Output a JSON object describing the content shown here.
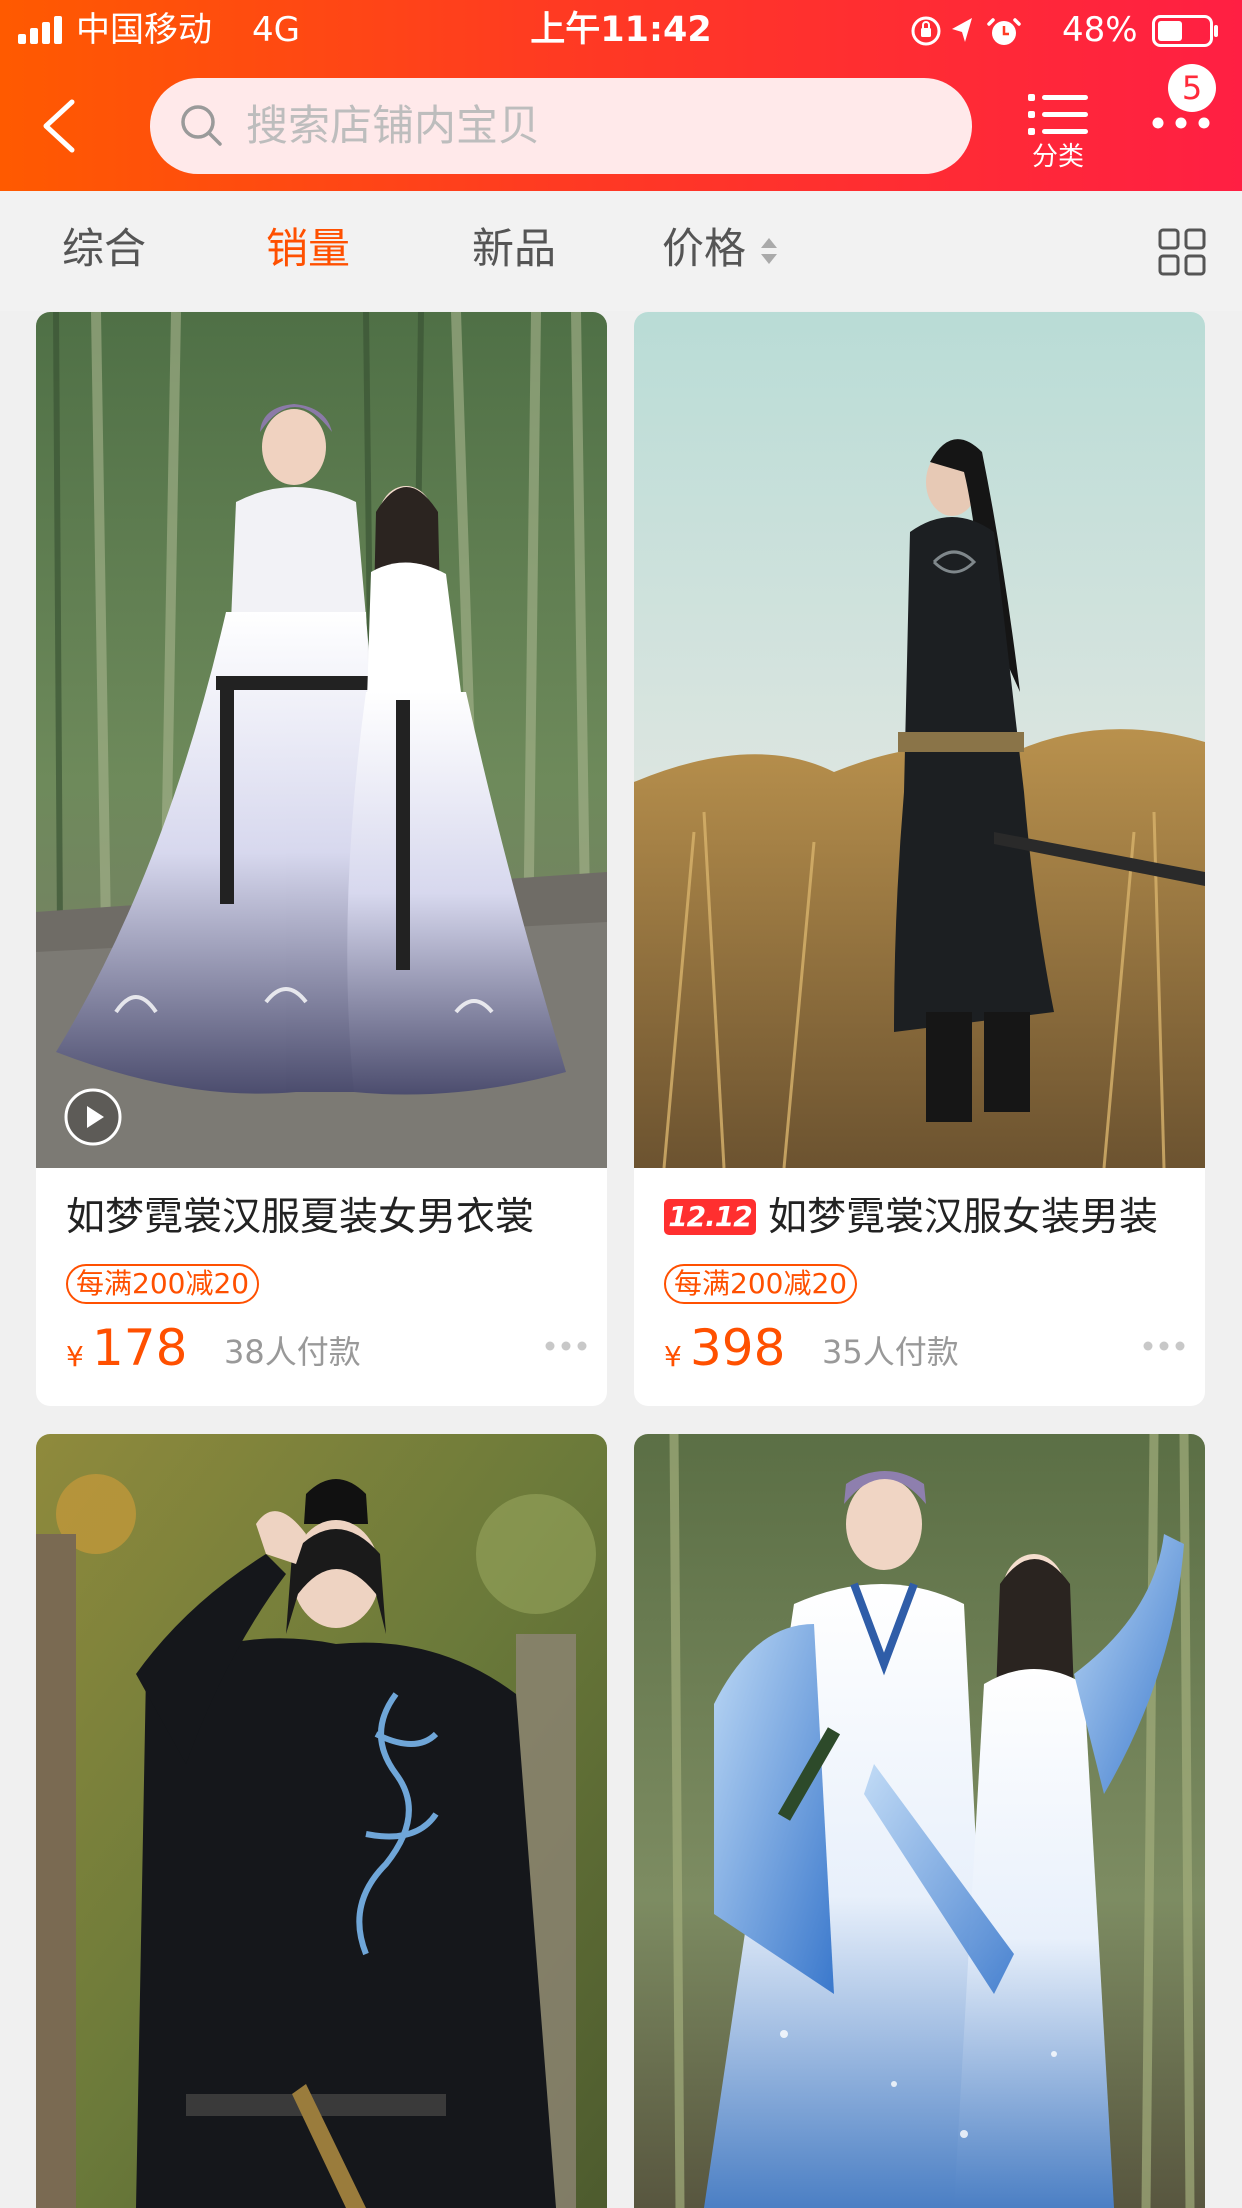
{
  "status_bar": {
    "carrier": "中国移动",
    "network": "4G",
    "time": "上午11:42",
    "battery": "48%",
    "battery_level": 0.48
  },
  "search": {
    "placeholder": "搜索店铺内宝贝"
  },
  "header": {
    "category_label": "分类",
    "notification_count": "5"
  },
  "filters": {
    "tabs": [
      {
        "label": "综合",
        "active": false
      },
      {
        "label": "销量",
        "active": true
      },
      {
        "label": "新品",
        "active": false
      },
      {
        "label": "价格",
        "active": false
      }
    ]
  },
  "products": [
    {
      "title": "如梦霓裳汉服夏装女男衣裳",
      "tag": "",
      "coupon": "每满200减20",
      "currency": "¥",
      "price": "178",
      "sold": "38人付款",
      "has_video": true
    },
    {
      "title": "如梦霓裳汉服女装男装",
      "tag": "12.12",
      "coupon": "每满200减20",
      "currency": "¥",
      "price": "398",
      "sold": "35人付款",
      "has_video": false
    },
    {
      "title": "",
      "tag": "",
      "coupon": "",
      "currency": "",
      "price": "",
      "sold": "",
      "has_video": false
    },
    {
      "title": "",
      "tag": "",
      "coupon": "",
      "currency": "",
      "price": "",
      "sold": "",
      "has_video": false
    }
  ],
  "colors": {
    "accent": "#ff5000",
    "header_start": "#ff5a00",
    "header_end": "#ff1f43",
    "search_bg": "#ffe9ea",
    "tag_red": "#ff2f2f"
  }
}
